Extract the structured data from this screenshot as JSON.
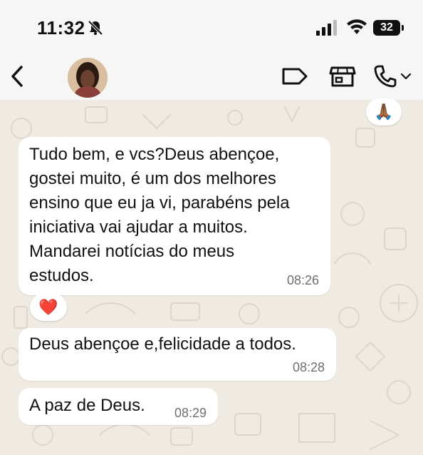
{
  "status_bar": {
    "time": "11:32",
    "battery": "32"
  },
  "header": {
    "back_icon": "chevron-left-icon",
    "avatar": "contact-avatar",
    "icons": [
      "label-icon",
      "store-icon",
      "phone-icon",
      "chevron-down-icon"
    ]
  },
  "messages": [
    {
      "lines": [
        "Tudo bem, e vcs?Deus abençoe,",
        "gostei muito, é um dos melhores",
        "ensino que eu ja vi, parabéns pela",
        "iniciativa vai ajudar  a muitos.",
        "Mandarei notícias do meus",
        "estudos."
      ],
      "time": "08:26",
      "reaction": "❤️"
    },
    {
      "text": "Deus abençoe e,felicidade a todos.",
      "time": "08:28"
    },
    {
      "text": "A paz de Deus.",
      "time": "08:29"
    }
  ],
  "top_reaction": "🙏🏾",
  "colors": {
    "chat_bg": "#efeae2",
    "bubble": "#ffffff",
    "header_bg": "#f6f6f6"
  }
}
